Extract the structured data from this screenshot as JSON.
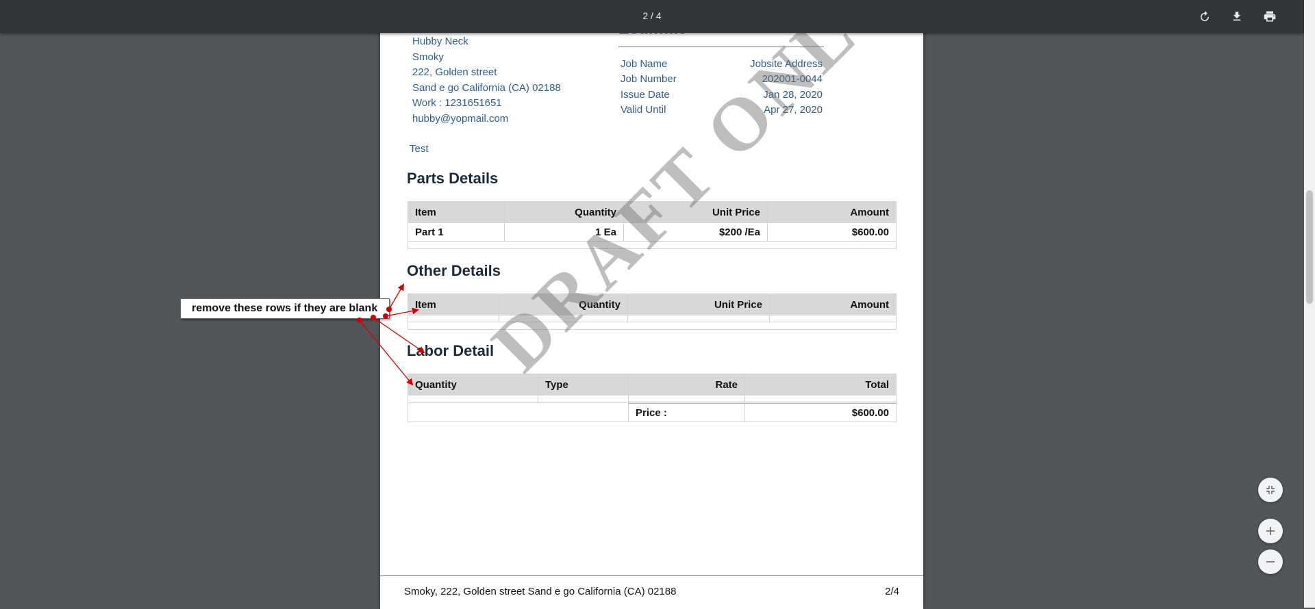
{
  "viewer": {
    "page_indicator": "2 / 4",
    "tool_icons": [
      "rotate-icon",
      "download-icon",
      "print-icon"
    ],
    "zoom_icons": [
      "fit-page-icon",
      "zoom-in-icon",
      "zoom-out-icon"
    ]
  },
  "customer": {
    "name": "Hubby Neck",
    "company": "Smoky",
    "street": "222, Golden street",
    "city_line": "Sand e go California (CA) 02188",
    "work_phone": "Work : 1231651651",
    "email": "hubby@yopmail.com",
    "note": "Test"
  },
  "estimate": {
    "title": "Estimate",
    "rows": [
      {
        "label": "Job Name",
        "value": "Jobsite Address"
      },
      {
        "label": "Job Number",
        "value": "202001-0044"
      },
      {
        "label": "Issue Date",
        "value": "Jan 28, 2020"
      },
      {
        "label": "Valid Until",
        "value": "Apr 27, 2020"
      }
    ]
  },
  "parts": {
    "heading": "Parts Details",
    "headers": [
      "Item",
      "Quantity",
      "Unit Price",
      "Amount"
    ],
    "rows": [
      {
        "item": "Part 1",
        "quantity": "1 Ea",
        "unit_price": "$200 /Ea",
        "amount": "$600.00"
      }
    ]
  },
  "other": {
    "heading": "Other Details",
    "headers": [
      "Item",
      "Quantity",
      "Unit Price",
      "Amount"
    ]
  },
  "labor": {
    "heading": "Labor Detail",
    "headers": [
      "Quantity",
      "Type",
      "Rate",
      "Total"
    ],
    "price_label": "Price :",
    "price_value": "$600.00"
  },
  "watermark": "DRAFT ONLY",
  "annotation": {
    "text": "remove these rows if they are blank",
    "arrow_color": "#d40000"
  },
  "footer": {
    "address": "Smoky, 222, Golden street Sand e go California (CA) 02188",
    "page": "2/4"
  },
  "colors": {
    "toolbar": "#323639",
    "viewer_background": "#525659",
    "link_text": "#2b5e8c",
    "table_header": "#d8d8d8"
  }
}
